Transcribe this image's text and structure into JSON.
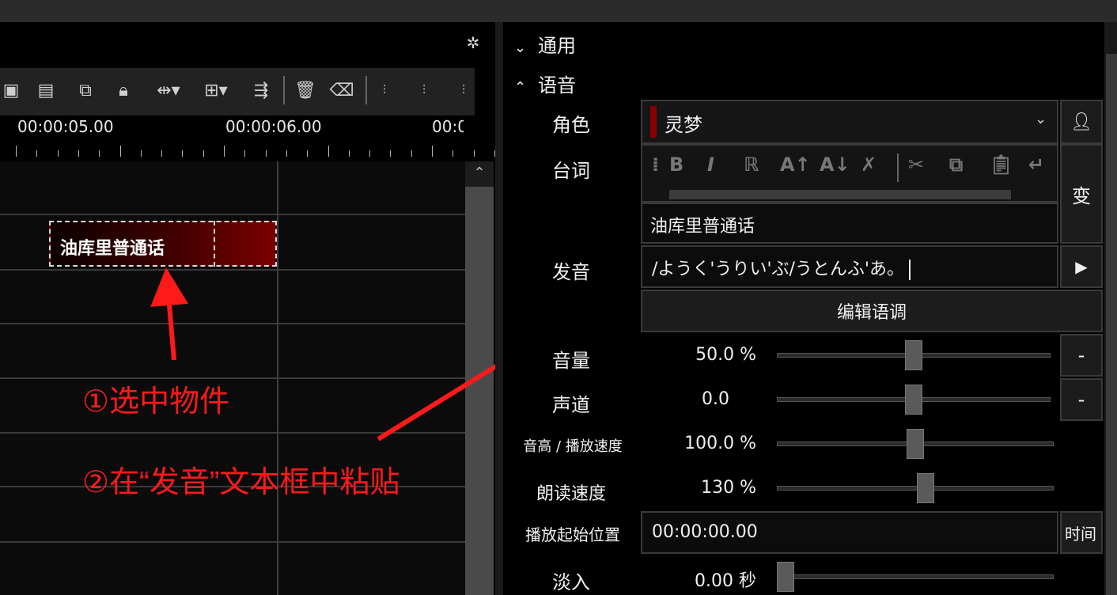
{
  "timeline": {
    "ruler_labels": [
      "00:00:05.00",
      "00:00:06.00",
      "00:0"
    ],
    "clip_text": "油库里普通话"
  },
  "annotations": {
    "step1": "①选中物件",
    "step2": "②在“发音”文本框中粘贴",
    "color": "#ff1a1a"
  },
  "panel": {
    "sections": [
      {
        "label": "通用",
        "expanded": false
      },
      {
        "label": "语音",
        "expanded": true
      }
    ],
    "character": {
      "label": "角色",
      "value": "灵梦",
      "color_marker": "#8b0000"
    },
    "lines": {
      "label": "台词",
      "text": "油库里普通话",
      "side_button": "变"
    },
    "pronunciation": {
      "label": "发音",
      "text": "/ようく'うりい'ぶ/うとんふ'あ。",
      "play_icon": "play-icon"
    },
    "edit_intonation_button": "编辑语调",
    "volume": {
      "label": "音量",
      "value": "50.0 %",
      "level": 0.5,
      "side_button": "-"
    },
    "pan": {
      "label": "声道",
      "value": "0.0",
      "level": 0.5,
      "side_button": "-"
    },
    "pitch": {
      "label": "音高 / 播放速度",
      "value": "100.0 %",
      "level": 0.5
    },
    "read_speed": {
      "label": "朗读速度",
      "value": "130 %",
      "level": 0.54
    },
    "start_position": {
      "label": "播放起始位置",
      "value": "00:00:00.00",
      "side_button": "时间"
    },
    "fade_in": {
      "label": "淡入",
      "value": "0.00 秒",
      "level": 0.0
    }
  }
}
